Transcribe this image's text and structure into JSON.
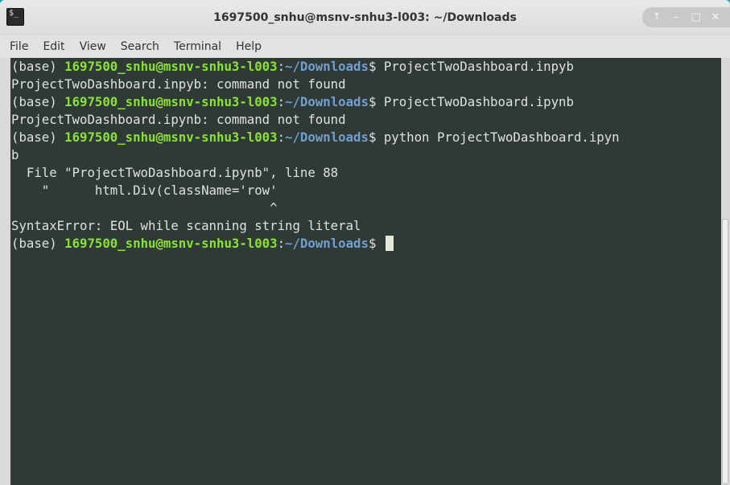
{
  "window": {
    "title": "1697500_snhu@msnv-snhu3-l003: ~/Downloads",
    "icon": "terminal-icon",
    "buttons": [
      "up-arrow-icon",
      "minimize-icon",
      "maximize-icon",
      "close-icon"
    ],
    "button_glyphs": {
      "up": "↑",
      "minimize": "–",
      "maximize": "□",
      "close": "✕"
    }
  },
  "menu": {
    "items": [
      "File",
      "Edit",
      "View",
      "Search",
      "Terminal",
      "Help"
    ]
  },
  "prompt": {
    "env": "(base) ",
    "user_host": "1697500_snhu@msnv-snhu3-l003",
    "colon": ":",
    "path": "~/Downloads",
    "symbol": "$ "
  },
  "lines": [
    {
      "type": "prompt",
      "cmd": "ProjectTwoDashboard.inpyb"
    },
    {
      "type": "output",
      "text": "ProjectTwoDashboard.inpyb: command not found"
    },
    {
      "type": "prompt",
      "cmd": "ProjectTwoDashboard.ipynb"
    },
    {
      "type": "output",
      "text": "ProjectTwoDashboard.ipynb: command not found"
    },
    {
      "type": "prompt",
      "cmd": "python ProjectTwoDashboard.ipyn"
    },
    {
      "type": "output",
      "text": "b"
    },
    {
      "type": "output",
      "text": "  File \"ProjectTwoDashboard.ipynb\", line 88"
    },
    {
      "type": "output",
      "text": "    \"      html.Div(className='row'"
    },
    {
      "type": "output",
      "text": "                                  ^"
    },
    {
      "type": "output",
      "text": "SyntaxError: EOL while scanning string literal"
    },
    {
      "type": "prompt",
      "cmd": "",
      "cursor": true
    }
  ],
  "colors": {
    "terminal_bg": "#2f3a37",
    "user_host": "#8ae234",
    "path": "#729fcf",
    "text": "#e0e0e0",
    "desktop": "#17a7a7"
  }
}
